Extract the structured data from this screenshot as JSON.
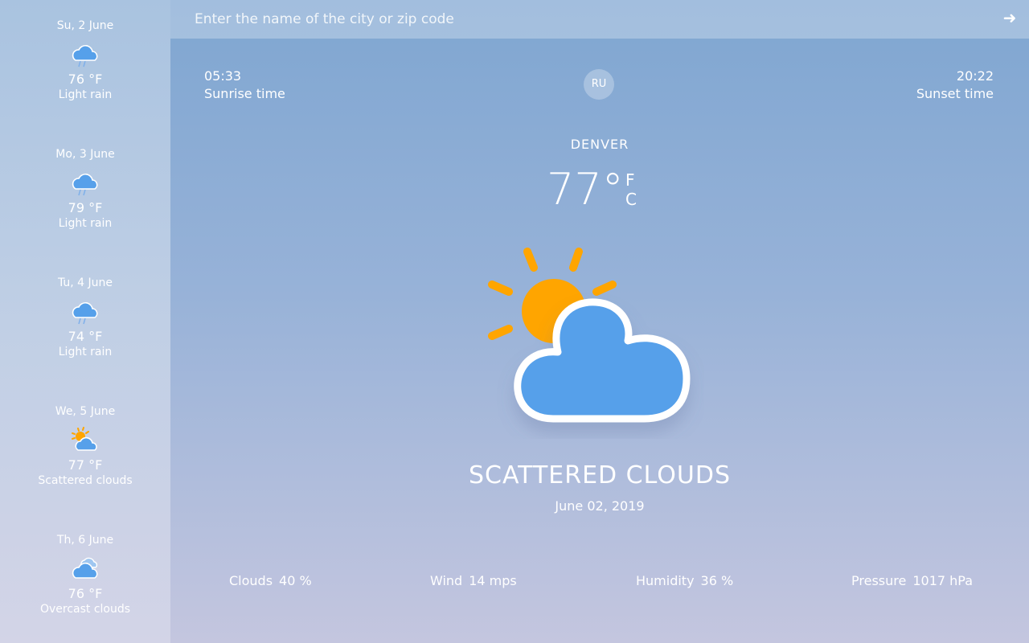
{
  "search": {
    "placeholder": "Enter the name of the city or zip code"
  },
  "language": "RU",
  "sunrise": {
    "time": "05:33",
    "label": "Sunrise time"
  },
  "sunset": {
    "time": "20:22",
    "label": "Sunset time"
  },
  "current": {
    "city": "DENVER",
    "temperature": "77°",
    "unit_f": "F",
    "unit_c": "C",
    "condition": "SCATTERED CLOUDS",
    "date": "June 02, 2019",
    "icon": "sun-behind-cloud-icon"
  },
  "stats": [
    {
      "label": "Clouds",
      "value": "40 %"
    },
    {
      "label": "Wind",
      "value": "14 mps"
    },
    {
      "label": "Humidity",
      "value": "36 %"
    },
    {
      "label": "Pressure",
      "value": "1017 hPa"
    }
  ],
  "forecast": [
    {
      "date": "Su, 2 June",
      "temp": "76 °F",
      "desc": "Light rain",
      "icon": "rain-cloud-icon"
    },
    {
      "date": "Mo, 3 June",
      "temp": "79 °F",
      "desc": "Light rain",
      "icon": "rain-cloud-icon"
    },
    {
      "date": "Tu, 4 June",
      "temp": "74 °F",
      "desc": "Light rain",
      "icon": "rain-cloud-icon"
    },
    {
      "date": "We, 5 June",
      "temp": "77 °F",
      "desc": "Scattered clouds",
      "icon": "sun-cloud-icon"
    },
    {
      "date": "Th, 6 June",
      "temp": "76 °F",
      "desc": "Overcast clouds",
      "icon": "overcast-cloud-icon"
    }
  ],
  "colors": {
    "sun": "#ffa500",
    "cloud": "#56a0ea",
    "cloud_outline": "#ffffff"
  }
}
